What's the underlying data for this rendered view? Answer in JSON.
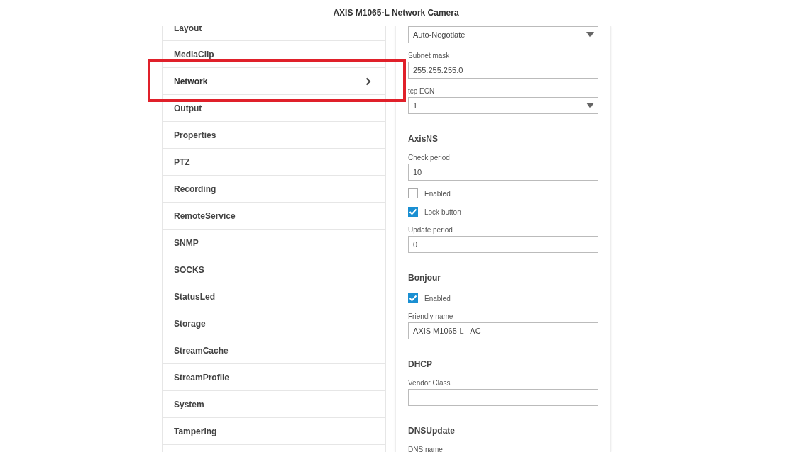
{
  "header": {
    "title": "AXIS M1065-L Network Camera"
  },
  "sidebar": {
    "items": [
      {
        "label": "Layout",
        "selected": false,
        "highlighted": false
      },
      {
        "label": "MediaClip",
        "selected": false,
        "highlighted": false
      },
      {
        "label": "Network",
        "selected": true,
        "highlighted": true
      },
      {
        "label": "Output",
        "selected": false,
        "highlighted": false
      },
      {
        "label": "Properties",
        "selected": false,
        "highlighted": false
      },
      {
        "label": "PTZ",
        "selected": false,
        "highlighted": false
      },
      {
        "label": "Recording",
        "selected": false,
        "highlighted": false
      },
      {
        "label": "RemoteService",
        "selected": false,
        "highlighted": false
      },
      {
        "label": "SNMP",
        "selected": false,
        "highlighted": false
      },
      {
        "label": "SOCKS",
        "selected": false,
        "highlighted": false
      },
      {
        "label": "StatusLed",
        "selected": false,
        "highlighted": false
      },
      {
        "label": "Storage",
        "selected": false,
        "highlighted": false
      },
      {
        "label": "StreamCache",
        "selected": false,
        "highlighted": false
      },
      {
        "label": "StreamProfile",
        "selected": false,
        "highlighted": false
      },
      {
        "label": "System",
        "selected": false,
        "highlighted": false
      },
      {
        "label": "Tampering",
        "selected": false,
        "highlighted": false
      }
    ]
  },
  "form": {
    "sections": [
      {
        "fields": [
          {
            "kind": "select",
            "value": "Auto-Negotiate"
          },
          {
            "kind": "text",
            "label": "Subnet mask",
            "value": "255.255.255.0"
          },
          {
            "kind": "select",
            "label": "tcp ECN",
            "value": "1"
          }
        ]
      },
      {
        "title": "AxisNS",
        "fields": [
          {
            "kind": "text",
            "label": "Check period",
            "value": "10"
          },
          {
            "kind": "checkbox",
            "label": "Enabled",
            "checked": false
          },
          {
            "kind": "checkbox",
            "label": "Lock button",
            "checked": true
          },
          {
            "kind": "text",
            "label": "Update period",
            "value": "0"
          }
        ]
      },
      {
        "title": "Bonjour",
        "fields": [
          {
            "kind": "checkbox",
            "label": "Enabled",
            "checked": true
          },
          {
            "kind": "text",
            "label": "Friendly name",
            "value": "AXIS M1065-L - AC"
          }
        ]
      },
      {
        "title": "DHCP",
        "fields": [
          {
            "kind": "text",
            "label": "Vendor Class"
          }
        ]
      },
      {
        "title": "DNSUpdate",
        "fields": [
          {
            "kind": "label",
            "label": "DNS name"
          }
        ]
      }
    ]
  }
}
